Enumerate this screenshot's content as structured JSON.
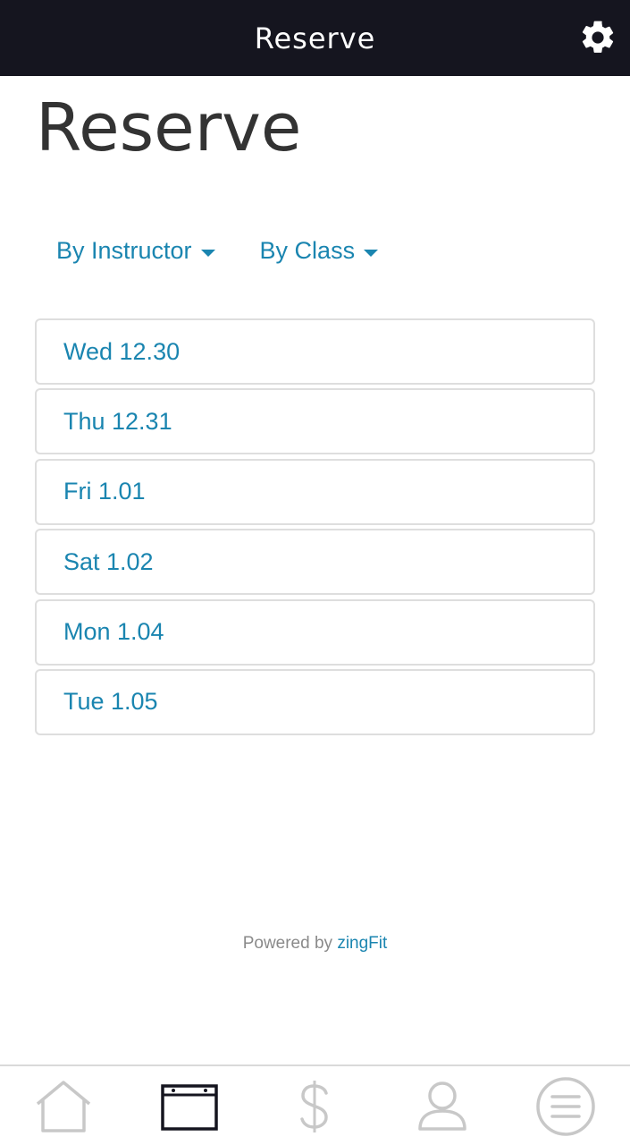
{
  "header": {
    "title": "Reserve",
    "settings_icon": "gear-icon"
  },
  "page": {
    "title": "Reserve"
  },
  "filters": {
    "by_instructor": "By Instructor",
    "by_class": "By Class"
  },
  "days": [
    {
      "label": "Wed 12.30"
    },
    {
      "label": "Thu 12.31"
    },
    {
      "label": "Fri 1.01"
    },
    {
      "label": "Sat 1.02"
    },
    {
      "label": "Mon 1.04"
    },
    {
      "label": "Tue 1.05"
    }
  ],
  "footer": {
    "powered_prefix": "Powered by ",
    "powered_brand": "zingFit"
  },
  "bottom_nav": {
    "items": [
      {
        "icon": "home-icon",
        "active": false
      },
      {
        "icon": "calendar-icon",
        "active": true
      },
      {
        "icon": "dollar-icon",
        "active": false
      },
      {
        "icon": "user-icon",
        "active": false
      },
      {
        "icon": "menu-icon",
        "active": false
      }
    ]
  },
  "colors": {
    "accent": "#1a85b0",
    "header_bg": "#15151f",
    "nav_inactive": "#c8c8c8",
    "nav_active": "#15151f"
  }
}
